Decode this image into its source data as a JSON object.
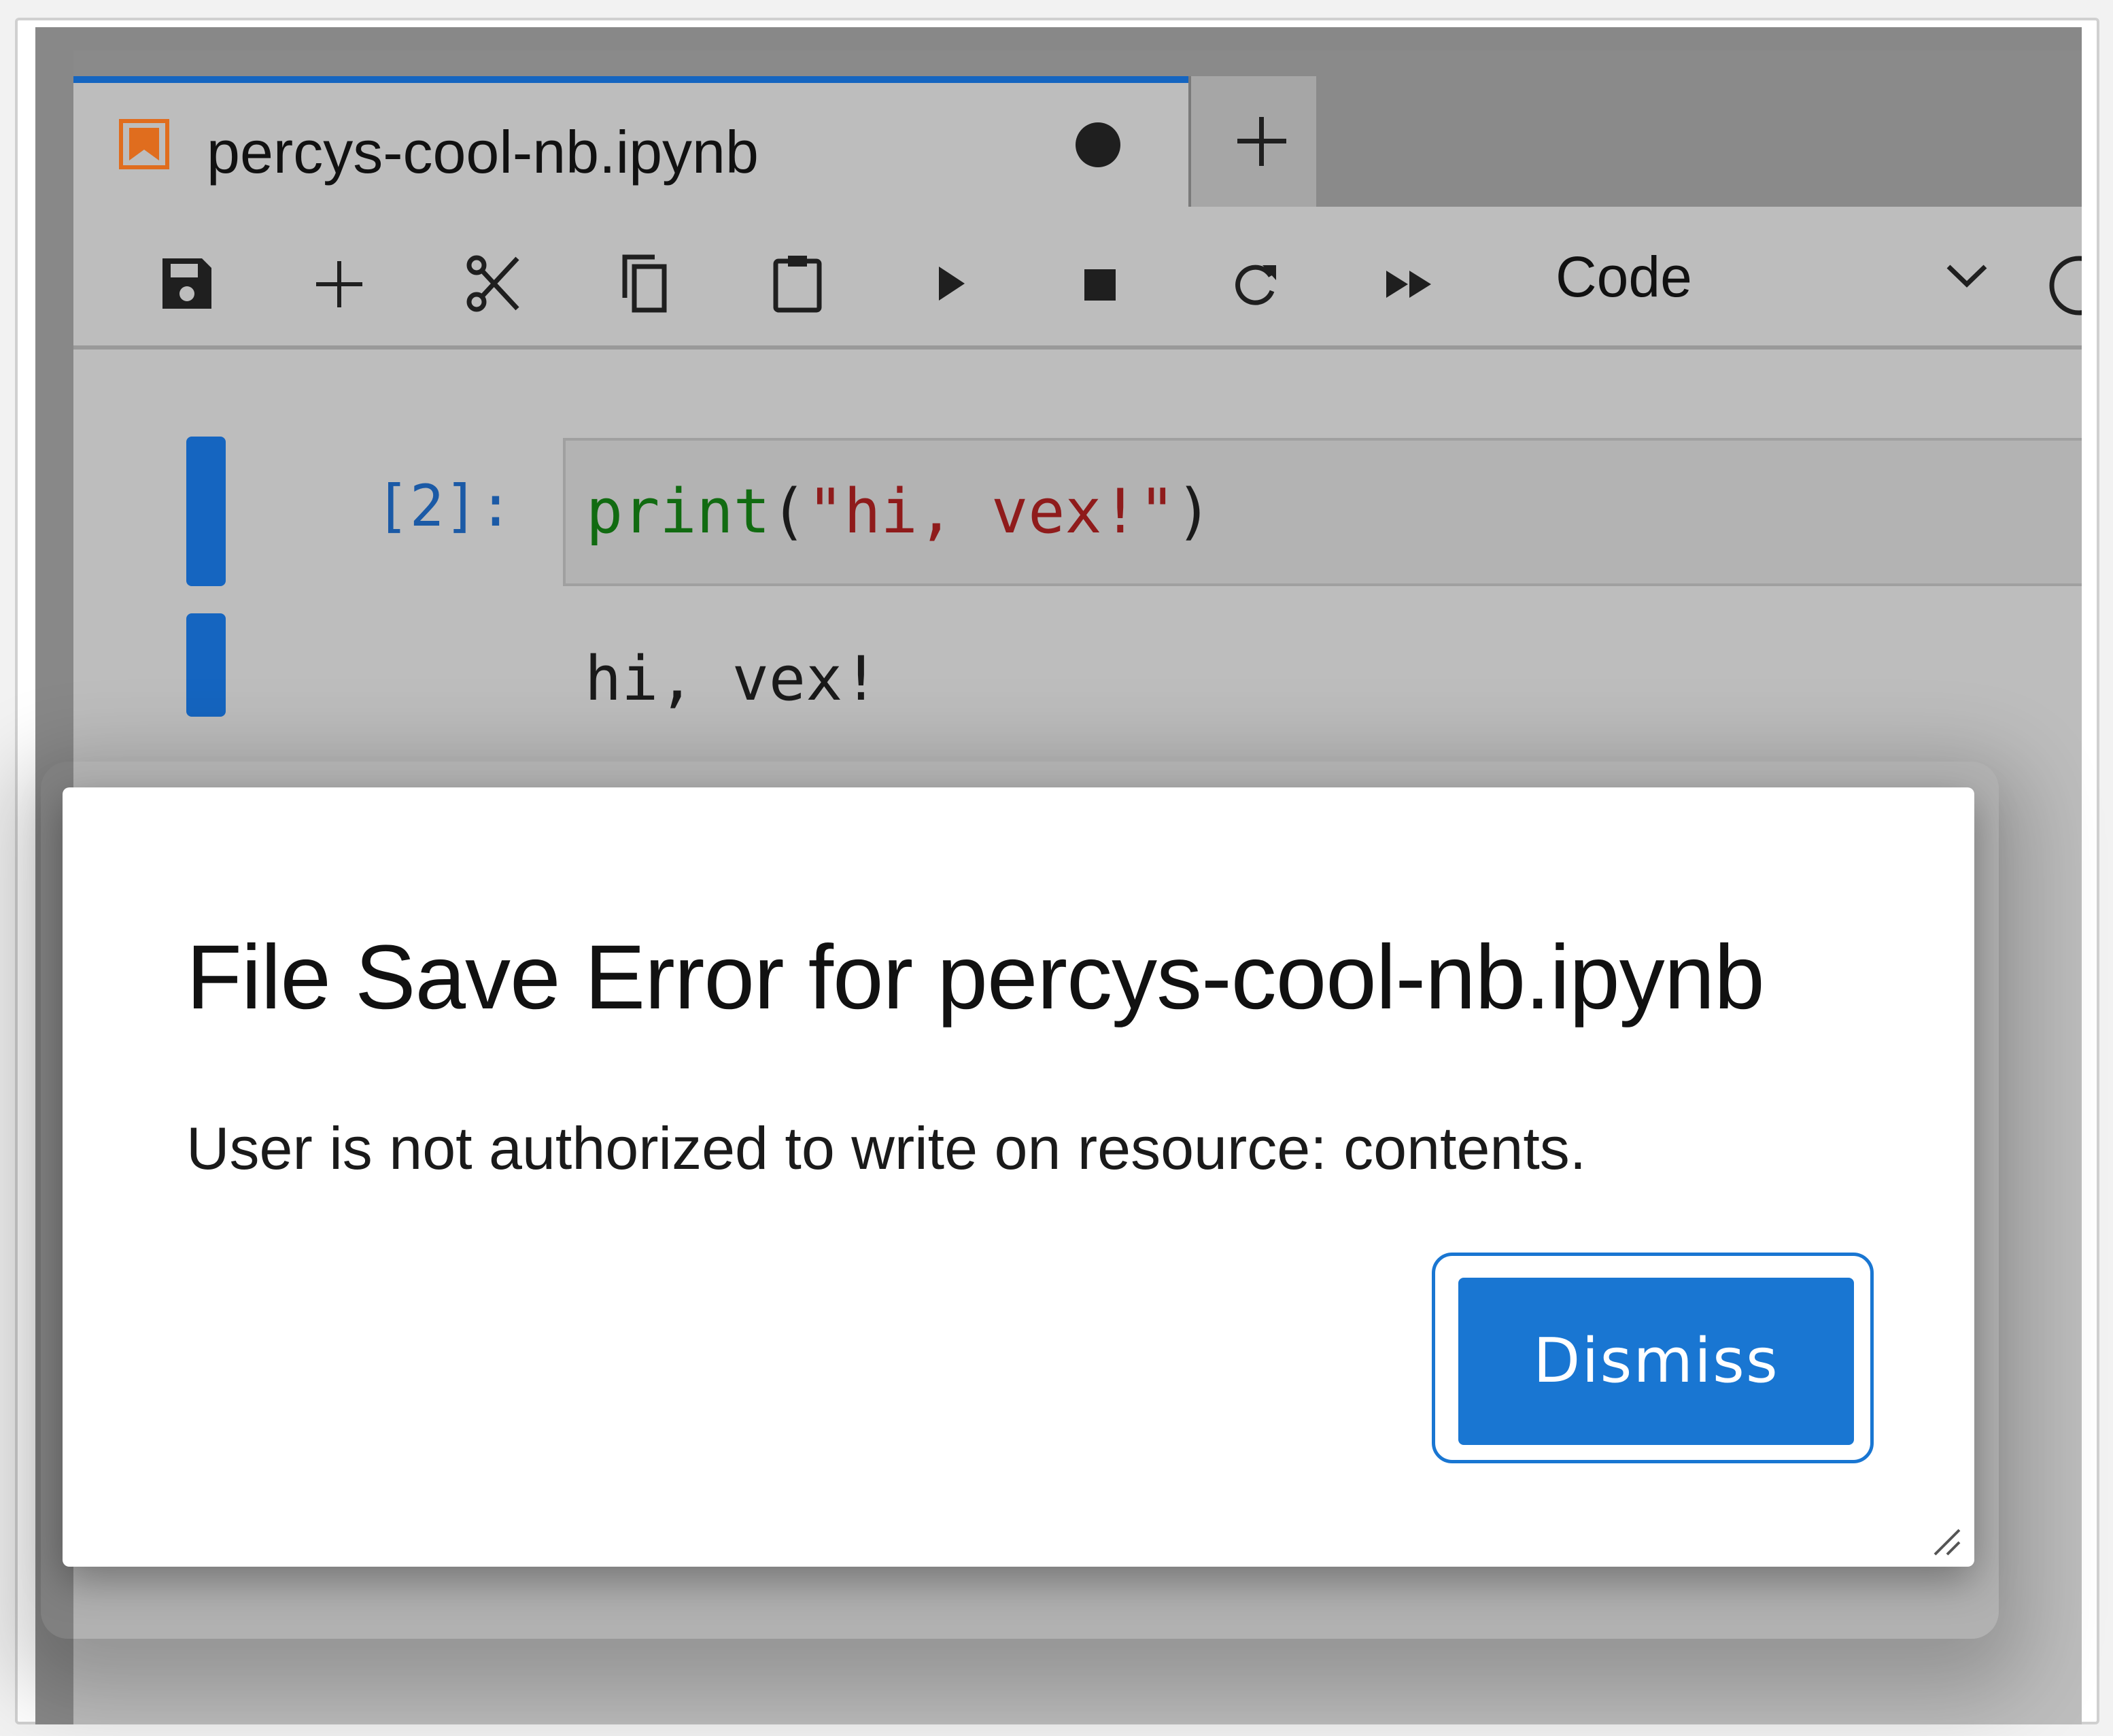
{
  "tab": {
    "title": "percys-cool-nb.ipynb",
    "icon": "notebook-icon",
    "dirty_indicator": "unsaved-changes-dot-icon",
    "new_tab_icon": "plus-icon"
  },
  "toolbar": {
    "buttons": [
      {
        "icon": "save-icon"
      },
      {
        "icon": "plus-icon"
      },
      {
        "icon": "cut-icon"
      },
      {
        "icon": "copy-icon"
      },
      {
        "icon": "paste-icon"
      },
      {
        "icon": "run-icon"
      },
      {
        "icon": "stop-icon"
      },
      {
        "icon": "restart-icon"
      },
      {
        "icon": "fast-forward-icon"
      }
    ],
    "cell_type": "Code",
    "kernel_icon": "kernel-status-icon"
  },
  "cell": {
    "prompt": "[2]:",
    "code": {
      "builtin": "print",
      "open_paren": "(",
      "string": "\"hi, vex!\"",
      "close_paren": ")"
    },
    "output": "hi, vex!"
  },
  "dialog": {
    "title": "File Save Error for percys-cool-nb.ipynb",
    "body": "User is not authorized to write on resource: contents.",
    "dismiss_label": "Dismiss"
  },
  "colors": {
    "accent": "#1976d2",
    "tab_top_border": "#1565c0",
    "notebook_icon": "#e06d1e",
    "string": "#8f1b1b",
    "builtin": "#116b11",
    "prompt": "#1b5aa6"
  }
}
